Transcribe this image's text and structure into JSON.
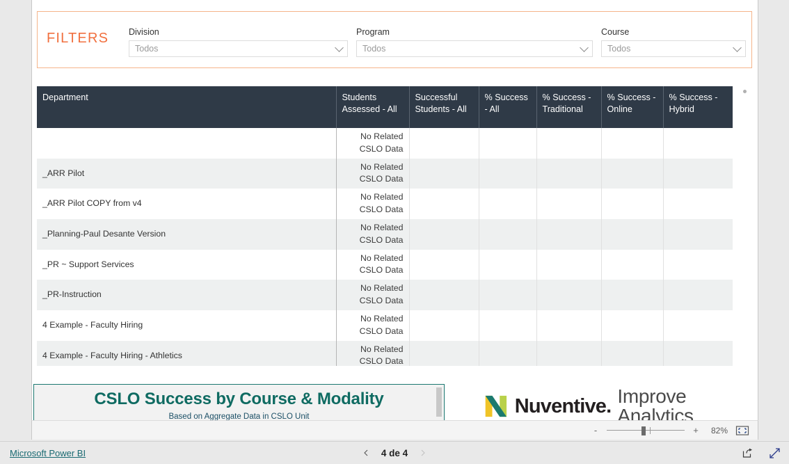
{
  "filters": {
    "title": "FILTERS",
    "fields": [
      {
        "label": "Division",
        "value": "Todos",
        "icon": "chevron-down-icon"
      },
      {
        "label": "Program",
        "value": "Todos",
        "icon": "chevron-down-icon"
      },
      {
        "label": "Course",
        "value": "Todos",
        "icon": "chevron-down-icon"
      }
    ]
  },
  "table": {
    "columns": [
      "Department",
      "Students Assessed - All",
      "Successful Students - All",
      "% Success - All",
      "% Success - Traditional",
      "% Success - Online",
      "% Success - Hybrid"
    ],
    "no_data_text": "No Related CSLO Data",
    "rows": [
      {
        "department": "",
        "students_assessed": "No Related CSLO Data",
        "successful_students": "",
        "pct_all": "",
        "pct_traditional": "",
        "pct_online": "",
        "pct_hybrid": ""
      },
      {
        "department": "_ARR Pilot",
        "students_assessed": "No Related CSLO Data",
        "successful_students": "",
        "pct_all": "",
        "pct_traditional": "",
        "pct_online": "",
        "pct_hybrid": ""
      },
      {
        "department": "_ARR Pilot COPY from v4",
        "students_assessed": "No Related CSLO Data",
        "successful_students": "",
        "pct_all": "",
        "pct_traditional": "",
        "pct_online": "",
        "pct_hybrid": ""
      },
      {
        "department": "_Planning-Paul Desante Version",
        "students_assessed": "No Related CSLO Data",
        "successful_students": "",
        "pct_all": "",
        "pct_traditional": "",
        "pct_online": "",
        "pct_hybrid": ""
      },
      {
        "department": "_PR ~ Support Services",
        "students_assessed": "No Related CSLO Data",
        "successful_students": "",
        "pct_all": "",
        "pct_traditional": "",
        "pct_online": "",
        "pct_hybrid": ""
      },
      {
        "department": "_PR-Instruction",
        "students_assessed": "No Related CSLO Data",
        "successful_students": "",
        "pct_all": "",
        "pct_traditional": "",
        "pct_online": "",
        "pct_hybrid": ""
      },
      {
        "department": "4 Example - Faculty Hiring",
        "students_assessed": "No Related CSLO Data",
        "successful_students": "",
        "pct_all": "",
        "pct_traditional": "",
        "pct_online": "",
        "pct_hybrid": ""
      },
      {
        "department": "4 Example - Faculty Hiring - Athletics",
        "students_assessed": "No Related CSLO Data",
        "successful_students": "",
        "pct_all": "",
        "pct_traditional": "",
        "pct_online": "",
        "pct_hybrid": ""
      }
    ]
  },
  "title_card": {
    "main": "CSLO Success by Course & Modality",
    "subtitle": "Based on Aggregate Data in CSLO Unit"
  },
  "branding": {
    "word": "Nuventive.",
    "tagline": "Improve Analytics"
  },
  "zoombar": {
    "minus": "-",
    "plus": "+",
    "percent": "82%",
    "fit_icon": "fit-to-page-icon"
  },
  "statusbar": {
    "powerbi_link": "Microsoft Power BI",
    "page_label": "4 de 4",
    "prev_icon": "chevron-left-icon",
    "next_icon": "chevron-right-icon",
    "share_icon": "share-icon",
    "fullscreen_icon": "fullscreen-icon"
  },
  "colors": {
    "accent_orange": "#f1703f",
    "header_dark": "#2f3a47",
    "teal": "#0f6b62",
    "link_teal": "#1a6a72",
    "row_alt": "#eef0f0"
  }
}
